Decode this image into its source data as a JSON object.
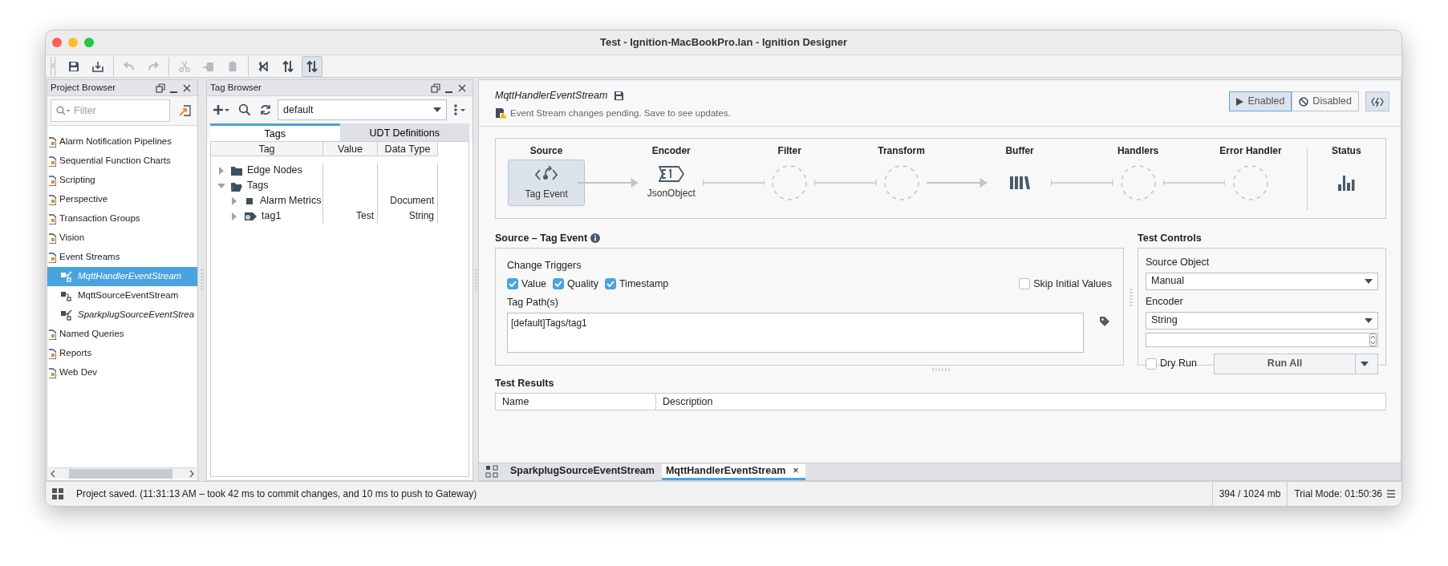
{
  "window": {
    "title": "Test - Ignition-MacBookPro.lan - Ignition Designer"
  },
  "toolbar": {
    "groups": [
      [
        {
          "kind": "save",
          "disabled": false,
          "selected": false
        },
        {
          "kind": "publish",
          "disabled": false,
          "selected": false
        }
      ],
      [
        {
          "kind": "undo",
          "disabled": true,
          "selected": false
        },
        {
          "kind": "redo",
          "disabled": true,
          "selected": false
        }
      ],
      [
        {
          "kind": "cut",
          "disabled": true,
          "selected": false
        },
        {
          "kind": "copy",
          "disabled": true,
          "selected": false
        },
        {
          "kind": "paste",
          "disabled": true,
          "selected": false
        }
      ],
      [
        {
          "kind": "crossed",
          "disabled": false,
          "selected": false
        },
        {
          "kind": "updown",
          "disabled": false,
          "selected": false
        },
        {
          "kind": "updown",
          "disabled": false,
          "selected": true
        }
      ]
    ]
  },
  "project_browser": {
    "title": "Project Browser",
    "filter": {
      "placeholder": "Filter"
    },
    "items": [
      {
        "label": "Alarm Notification Pipelines",
        "selected": false
      },
      {
        "label": "Sequential Function Charts",
        "selected": false
      },
      {
        "label": "Scripting",
        "selected": false
      },
      {
        "label": "Perspective",
        "selected": false
      },
      {
        "label": "Transaction Groups",
        "selected": false
      },
      {
        "label": "Vision",
        "selected": false
      },
      {
        "label": "Event Streams",
        "selected": false,
        "children": [
          {
            "label": "MqttHandlerEventStream",
            "selected": true,
            "modified": true
          },
          {
            "label": "MqttSourceEventStream",
            "selected": false,
            "modified": false
          },
          {
            "label": "SparkplugSourceEventStrea",
            "selected": false,
            "modified": true
          }
        ]
      },
      {
        "label": "Named Queries",
        "selected": false
      },
      {
        "label": "Reports",
        "selected": false
      },
      {
        "label": "Web Dev",
        "selected": false
      }
    ]
  },
  "tag_browser": {
    "title": "Tag Browser",
    "provider": "default",
    "tabs": [
      {
        "label": "Tags",
        "selected": true
      },
      {
        "label": "UDT Definitions",
        "selected": false
      }
    ],
    "columns": [
      "Tag",
      "Value",
      "Data Type"
    ],
    "rows": [
      {
        "kind": "folder",
        "name": "Edge Nodes",
        "expanded": false
      },
      {
        "kind": "folder",
        "name": "Tags",
        "expanded": true,
        "children": [
          {
            "kind": "udt",
            "name": "Alarm Metrics",
            "expanded": false,
            "data_type": "Document"
          },
          {
            "kind": "tag",
            "name": "tag1",
            "expanded": false,
            "value": "Test",
            "data_type": "String"
          }
        ]
      }
    ]
  },
  "editor": {
    "title": "MqttHandlerEventStream",
    "notice": "Event Stream changes pending. Save to see updates.",
    "modes": [
      {
        "label": "Enabled",
        "kind": "play",
        "selected": true
      },
      {
        "label": "Disabled",
        "kind": "block",
        "selected": false
      }
    ],
    "pipeline": {
      "stages": [
        {
          "label": "Source",
          "kind": "source",
          "caption": "Tag Event",
          "selected": true
        },
        {
          "label": "Encoder",
          "kind": "encoder",
          "caption": "JsonObject",
          "selected": false
        },
        {
          "label": "Filter",
          "kind": "empty",
          "selected": false
        },
        {
          "label": "Transform",
          "kind": "empty",
          "selected": false
        },
        {
          "label": "Buffer",
          "kind": "buffer",
          "selected": false
        },
        {
          "label": "Handlers",
          "kind": "empty",
          "selected": false
        },
        {
          "label": "Error Handler",
          "kind": "empty",
          "selected": false
        }
      ],
      "status": {
        "label": "Status"
      }
    },
    "source_section": {
      "title": "Source – Tag Event",
      "triggers_label": "Change Triggers",
      "triggers": [
        {
          "label": "Value",
          "checked": true
        },
        {
          "label": "Quality",
          "checked": true
        },
        {
          "label": "Timestamp",
          "checked": true
        }
      ],
      "skip_initial": {
        "label": "Skip Initial Values",
        "checked": false
      },
      "tag_paths_label": "Tag Path(s)",
      "tag_paths": "[default]Tags/tag1"
    },
    "test_controls": {
      "title": "Test Controls",
      "source_object_label": "Source Object",
      "source_object": "Manual",
      "encoder_label": "Encoder",
      "encoder": "String",
      "dry_run": {
        "label": "Dry Run",
        "checked": false
      },
      "run_button": "Run All"
    },
    "test_results": {
      "title": "Test Results",
      "columns": [
        "Name",
        "Description"
      ]
    },
    "tabs": [
      {
        "label": "SparkplugSourceEventStream",
        "selected": false
      },
      {
        "label": "MqttHandlerEventStream",
        "selected": true,
        "close": "×"
      }
    ]
  },
  "status_bar": {
    "message": "Project saved. (11:31:13 AM – took 42 ms to commit changes, and 10 ms to push to Gateway)",
    "memory": "394 / 1024 mb",
    "trial": "Trial Mode: 01:50:36"
  }
}
